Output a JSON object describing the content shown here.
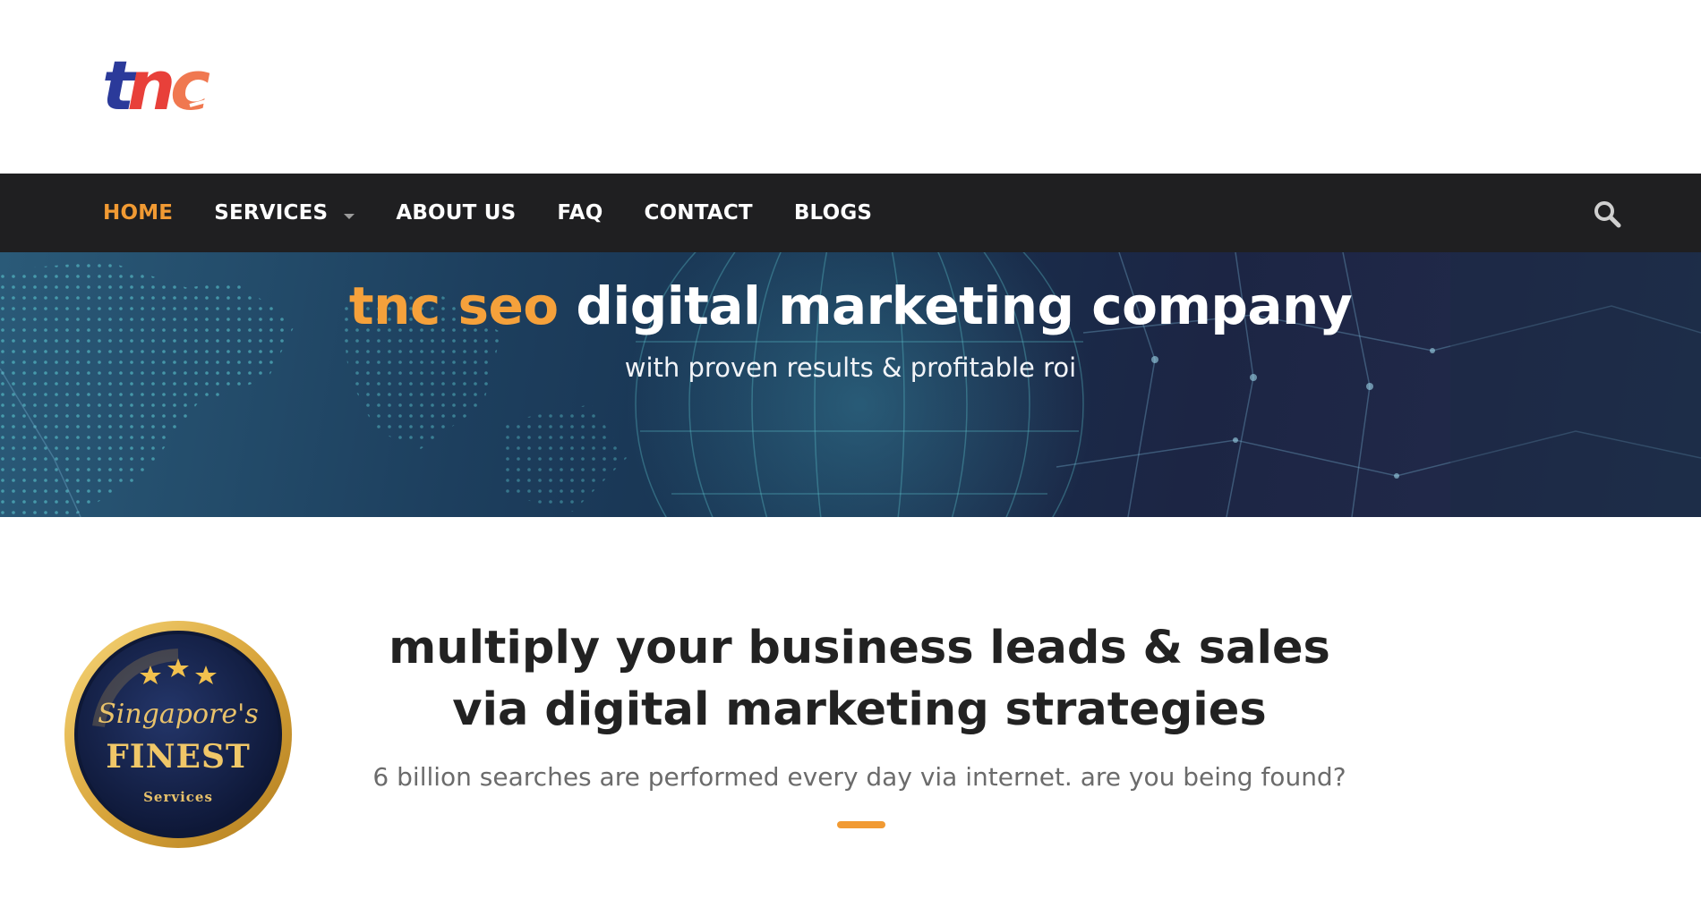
{
  "brand": {
    "logo_text": "tnc",
    "colors": {
      "accent": "#f19a33",
      "logo_blue": "#2b3a9a",
      "logo_red": "#e8403a",
      "nav_bg": "#1f1f21"
    }
  },
  "nav": {
    "items": [
      {
        "label": "HOME",
        "active": true
      },
      {
        "label": "SERVICES",
        "has_dropdown": true
      },
      {
        "label": "ABOUT US"
      },
      {
        "label": "FAQ"
      },
      {
        "label": "CONTACT"
      },
      {
        "label": "BLOGS"
      }
    ],
    "search_icon": "search-icon"
  },
  "hero": {
    "title_accent": "tnc seo",
    "title_rest": " digital marketing company",
    "subtitle": "with proven results & profitable roi"
  },
  "badge": {
    "script_text": "Singapore's",
    "main_text": "FINEST",
    "sub_text": "Services",
    "stars": 3
  },
  "main": {
    "headline_line1": "multiply your business leads & sales",
    "headline_line2": "via digital marketing strategies",
    "tagline": "6 billion searches are performed every day via internet. are you being found?"
  }
}
